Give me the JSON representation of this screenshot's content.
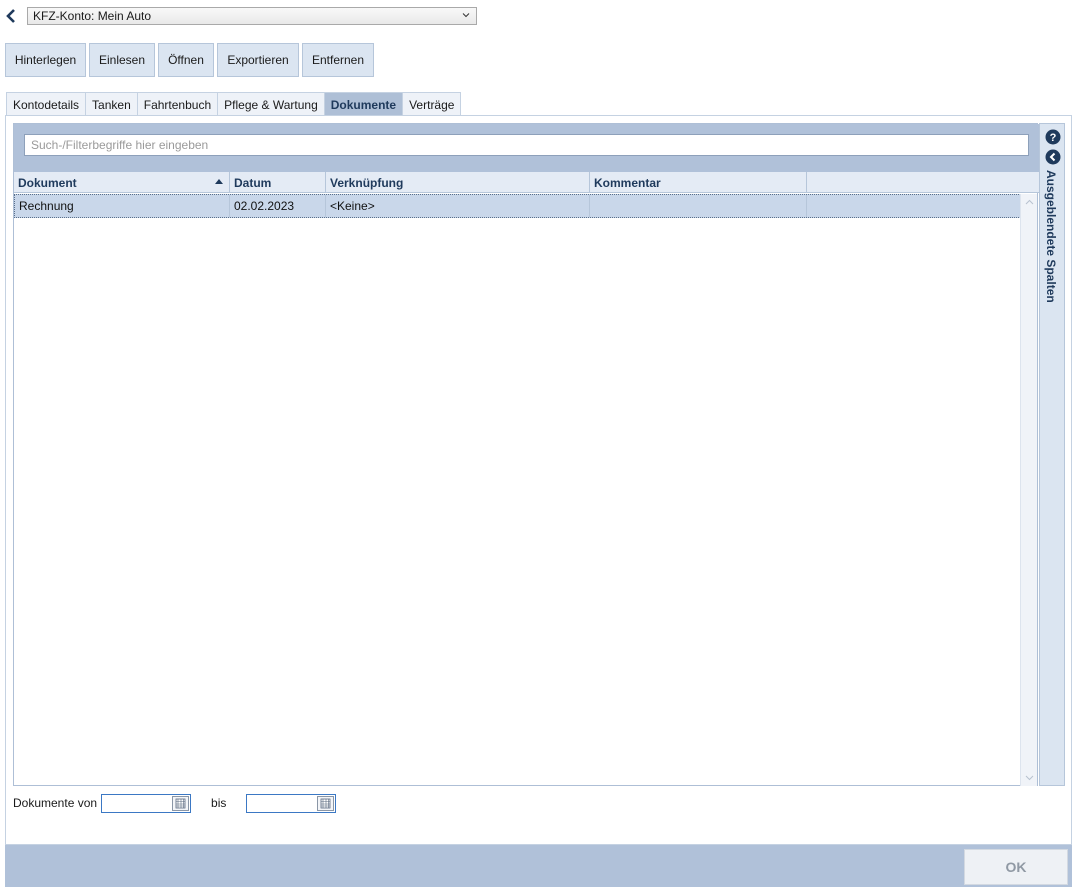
{
  "account": {
    "selected": "KFZ-Konto: Mein Auto"
  },
  "toolbar": {
    "hinterlegen": "Hinterlegen",
    "einlesen": "Einlesen",
    "oeffnen": "Öffnen",
    "exportieren": "Exportieren",
    "entfernen": "Entfernen"
  },
  "tabs": [
    {
      "label": "Kontodetails"
    },
    {
      "label": "Tanken"
    },
    {
      "label": "Fahrtenbuch"
    },
    {
      "label": "Pflege & Wartung"
    },
    {
      "label": "Dokumente"
    },
    {
      "label": "Verträge"
    }
  ],
  "active_tab": "Dokumente",
  "filter": {
    "placeholder": "Such-/Filterbegriffe hier eingeben",
    "value": ""
  },
  "grid": {
    "columns": [
      "Dokument",
      "Datum",
      "Verknüpfung",
      "Kommentar",
      ""
    ],
    "sorted_column": "Dokument",
    "sort_direction": "ascending",
    "rows": [
      {
        "dokument": "Rechnung",
        "datum": "02.02.2023",
        "verknuepfung": "<Keine>",
        "kommentar": ""
      }
    ]
  },
  "side_panel": {
    "label": "Ausgeblendete Spalten",
    "help_icon": "question-circle-icon",
    "collapse_icon": "chevron-left-circle-icon"
  },
  "date_range": {
    "from_label": "Dokumente von",
    "from_value": "",
    "to_label": "bis",
    "to_value": ""
  },
  "footer": {
    "ok_label": "OK"
  },
  "colors": {
    "accent": "#1f3a5c",
    "panel_blue": "#b0c1d9",
    "selected_row": "#c9d7ea"
  }
}
